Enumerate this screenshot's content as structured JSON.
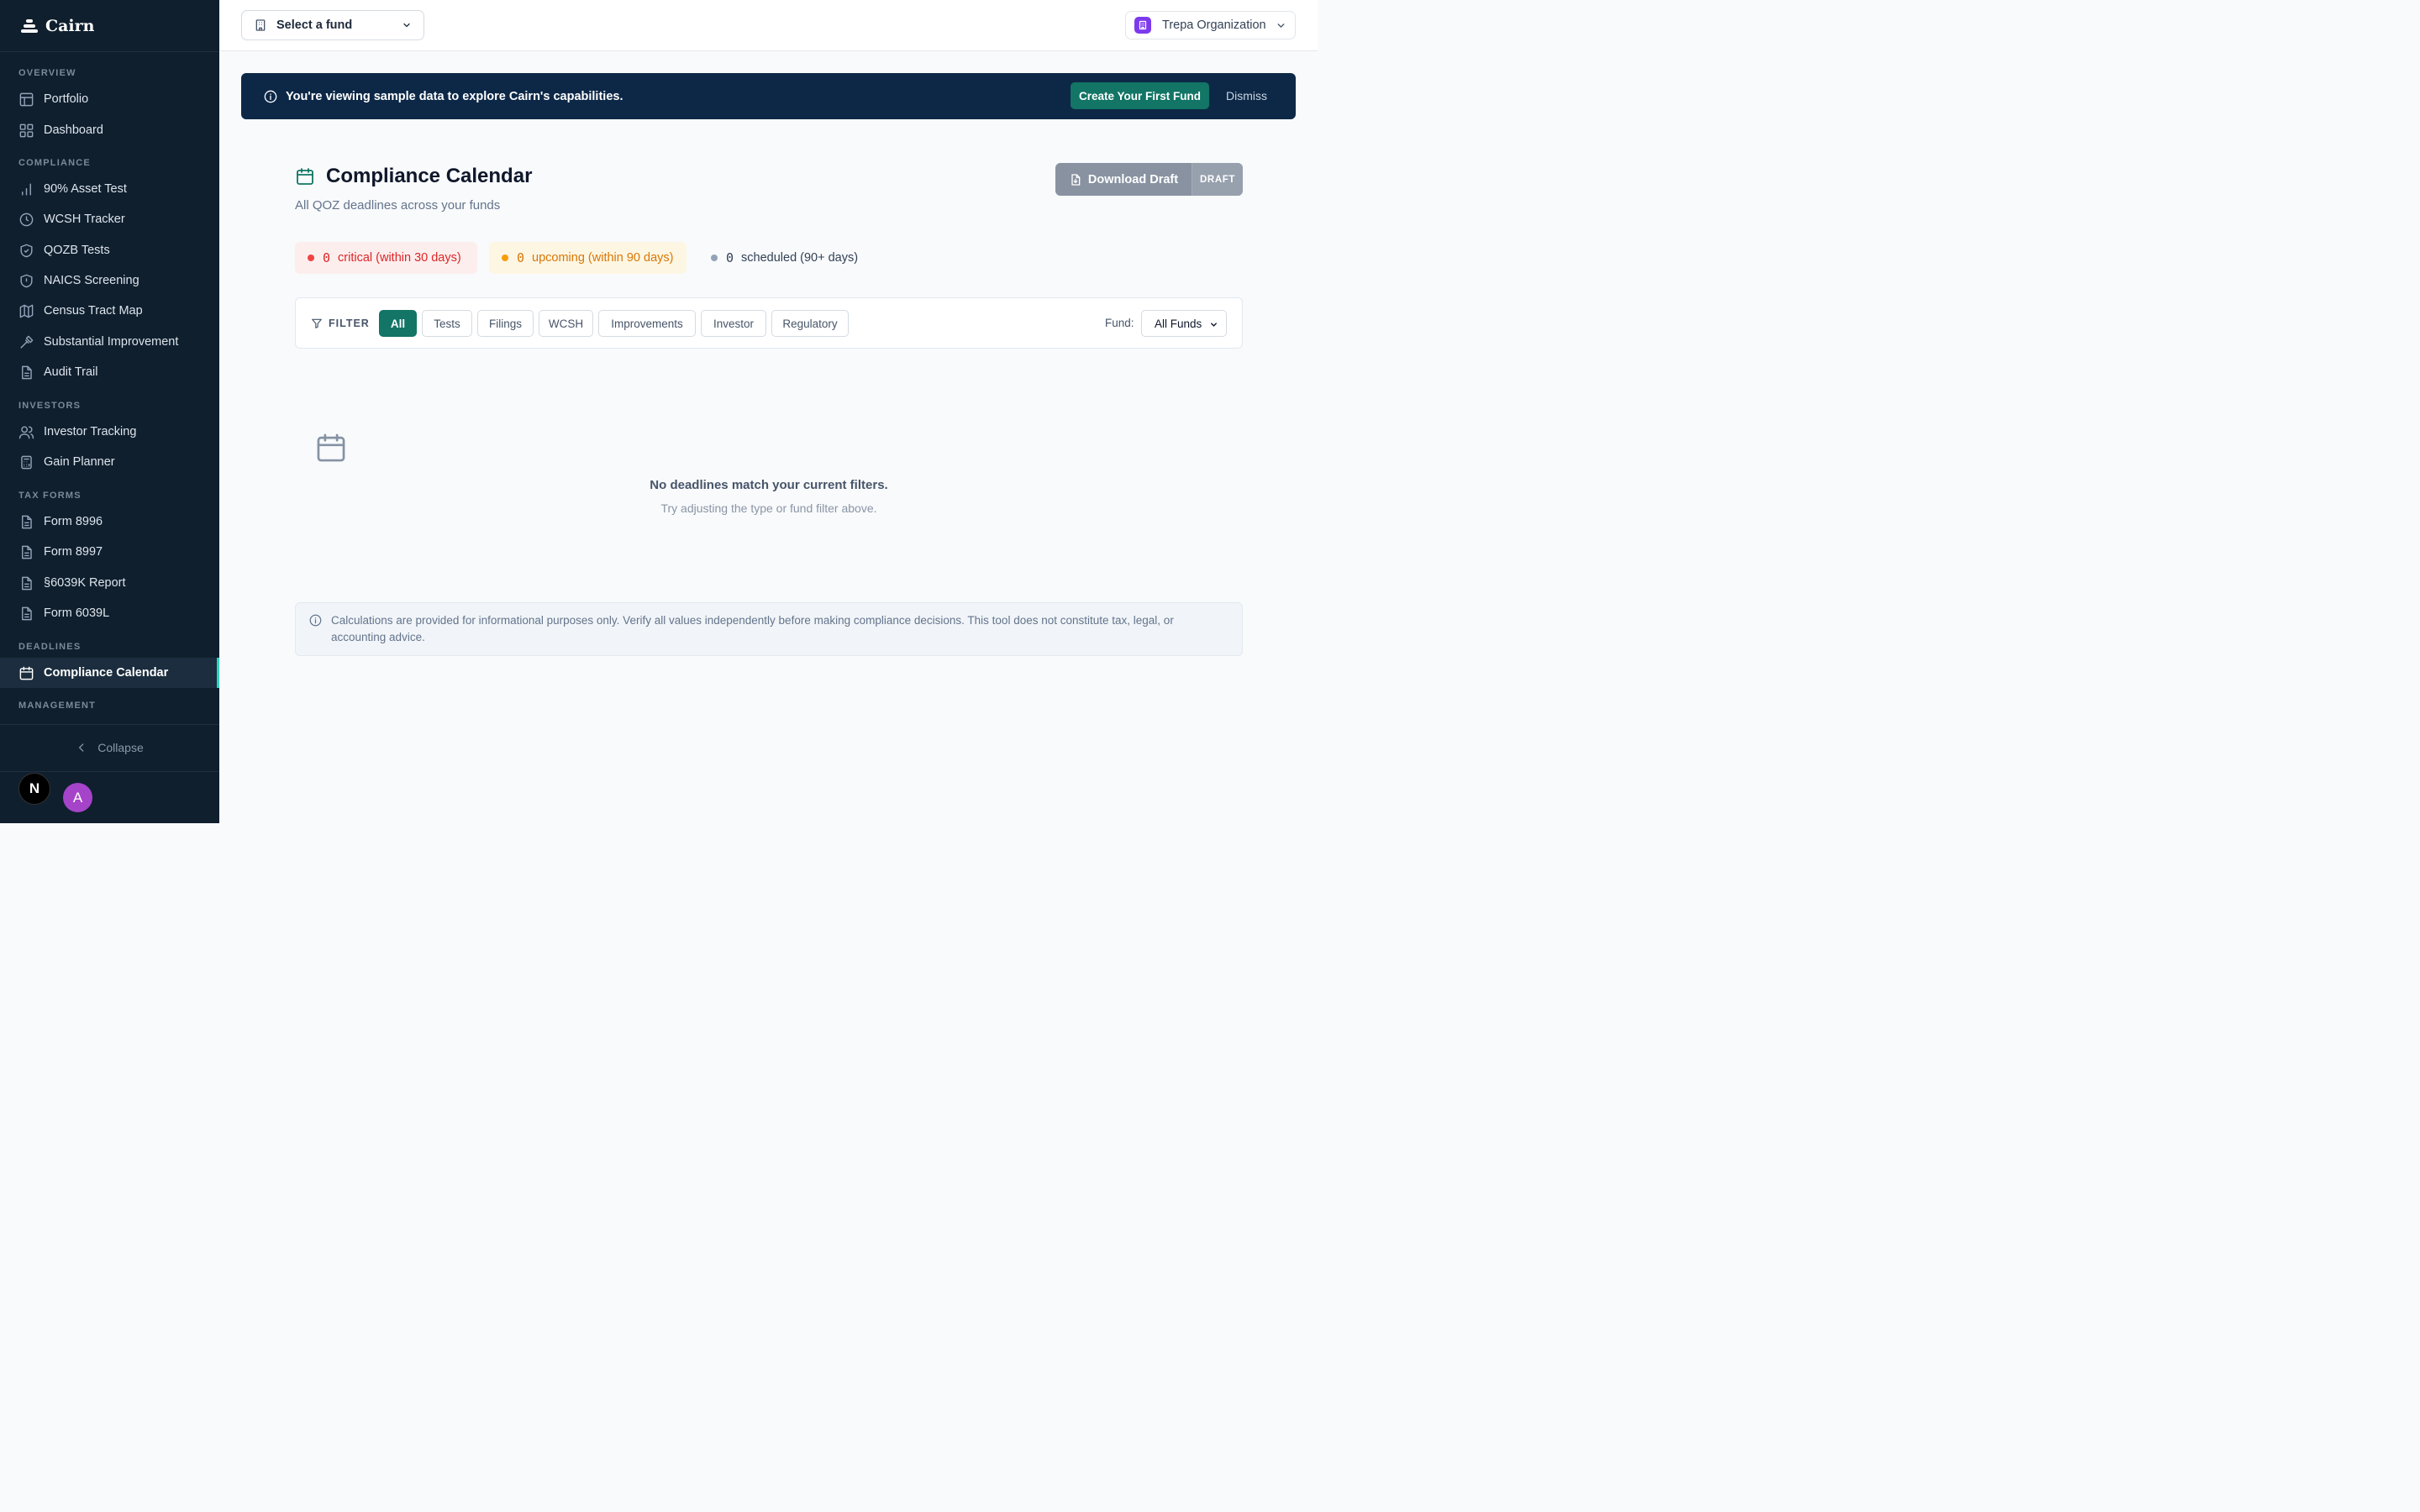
{
  "app": {
    "name": "Cairn"
  },
  "sidebar": {
    "sections": {
      "overview": "OVERVIEW",
      "compliance": "COMPLIANCE",
      "investors": "INVESTORS",
      "tax_forms": "TAX FORMS",
      "deadlines": "DEADLINES",
      "management": "MANAGEMENT"
    },
    "items": [
      {
        "label": "Portfolio",
        "icon": "layout-icon"
      },
      {
        "label": "Dashboard",
        "icon": "grid-icon"
      },
      {
        "label": "90% Asset Test",
        "icon": "bar-chart-icon"
      },
      {
        "label": "WCSH Tracker",
        "icon": "clock-icon"
      },
      {
        "label": "QOZB Tests",
        "icon": "shield-check-icon"
      },
      {
        "label": "NAICS Screening",
        "icon": "shield-icon"
      },
      {
        "label": "Census Tract Map",
        "icon": "map-icon"
      },
      {
        "label": "Substantial Improvement",
        "icon": "hammer-icon"
      },
      {
        "label": "Audit Trail",
        "icon": "document-icon"
      },
      {
        "label": "Investor Tracking",
        "icon": "users-icon"
      },
      {
        "label": "Gain Planner",
        "icon": "calculator-icon"
      },
      {
        "label": "Form 8996",
        "icon": "document-icon"
      },
      {
        "label": "Form 8997",
        "icon": "document-icon"
      },
      {
        "label": "§6039K Report",
        "icon": "document-icon"
      },
      {
        "label": "Form 6039L",
        "icon": "document-icon"
      },
      {
        "label": "Compliance Calendar",
        "icon": "calendar-icon",
        "active": true
      }
    ],
    "collapse_label": "Collapse",
    "dev_badge": "N",
    "avatar_initial": "A"
  },
  "topbar": {
    "fund_select": "Select a fund",
    "organization": "Trepa Organization"
  },
  "banner": {
    "message": "You're viewing sample data to explore Cairn's capabilities.",
    "create_label": "Create Your First Fund",
    "dismiss_label": "Dismiss"
  },
  "page": {
    "title": "Compliance Calendar",
    "subtitle": "All QOZ deadlines across your funds",
    "download_label": "Download Draft",
    "draft_badge": "DRAFT"
  },
  "stats": {
    "critical": {
      "count": "0",
      "label": "critical (within 30 days)"
    },
    "upcoming": {
      "count": "0",
      "label": "upcoming (within 90 days)"
    },
    "scheduled": {
      "count": "0",
      "label": "scheduled (90+ days)"
    }
  },
  "filters": {
    "label": "FILTER",
    "chips": [
      "All",
      "Tests",
      "Filings",
      "WCSH",
      "Improvements",
      "Investor",
      "Regulatory"
    ],
    "active": "All",
    "fund_label": "Fund:",
    "fund_value": "All Funds"
  },
  "empty": {
    "title": "No deadlines match your current filters.",
    "subtitle": "Try adjusting the type or fund filter above."
  },
  "disclaimer": "Calculations are provided for informational purposes only. Verify all values independently before making compliance decisions. This tool does not constitute tax, legal, or accounting advice.",
  "colors": {
    "sidebar_bg": "#0f1f2e",
    "banner_bg": "#0d2847",
    "accent": "#127565",
    "critical": "#dc2626",
    "upcoming": "#d97706"
  }
}
